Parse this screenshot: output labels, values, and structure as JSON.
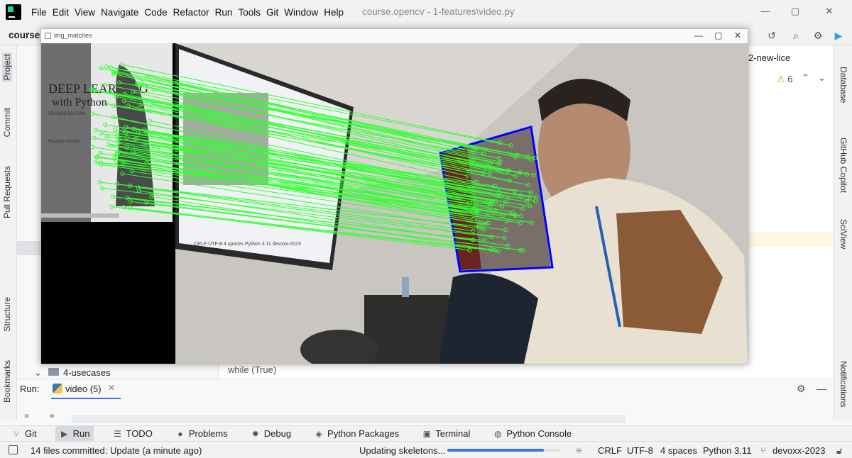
{
  "menu": {
    "items": [
      "File",
      "Edit",
      "View",
      "Navigate",
      "Code",
      "Refactor",
      "Run",
      "Tools",
      "Git",
      "Window",
      "Help"
    ],
    "title": "course.opencv - 1-features\\video.py"
  },
  "project": {
    "name": "course.c"
  },
  "editor": {
    "tab_fragment": "2-new-lice",
    "warning_count": "6",
    "tree_item": "4-usecases",
    "code_line": "while (True)"
  },
  "left_tools": [
    "Project",
    "Commit",
    "Pull Requests",
    "Structure",
    "Bookmarks"
  ],
  "right_tools": [
    "Database",
    "GitHub Copilot",
    "SciView",
    "Notifications"
  ],
  "run": {
    "label": "Run:",
    "tab": "video (5)",
    "prompt1": "»",
    "prompt2": "»"
  },
  "bottom_tools": [
    "Git",
    "Run",
    "TODO",
    "Problems",
    "Debug",
    "Python Packages",
    "Terminal",
    "Python Console"
  ],
  "bottom_active": "Run",
  "status": {
    "commit_msg": "14 files committed: Update (a minute ago)",
    "task": "Updating skeletons...",
    "progress": 0.85,
    "line_sep": "CRLF",
    "encoding": "UTF-8",
    "indent": "4 spaces",
    "interpreter": "Python 3.11",
    "branch": "devoxx-2023"
  },
  "cv_window": {
    "title": "img_matches",
    "book_title_line1": "DEEP LEARNING",
    "book_title_line2": "with Python",
    "book_edition": "SECOND EDITION",
    "book_author": "François Chollet",
    "screen_status": "CRLF  UTF-8  4 spaces  Python 3.11  devoxx-2023"
  },
  "colors": {
    "match_line": "#33ff33",
    "homography_box": "#0000ff",
    "progress": "#3574f0"
  }
}
